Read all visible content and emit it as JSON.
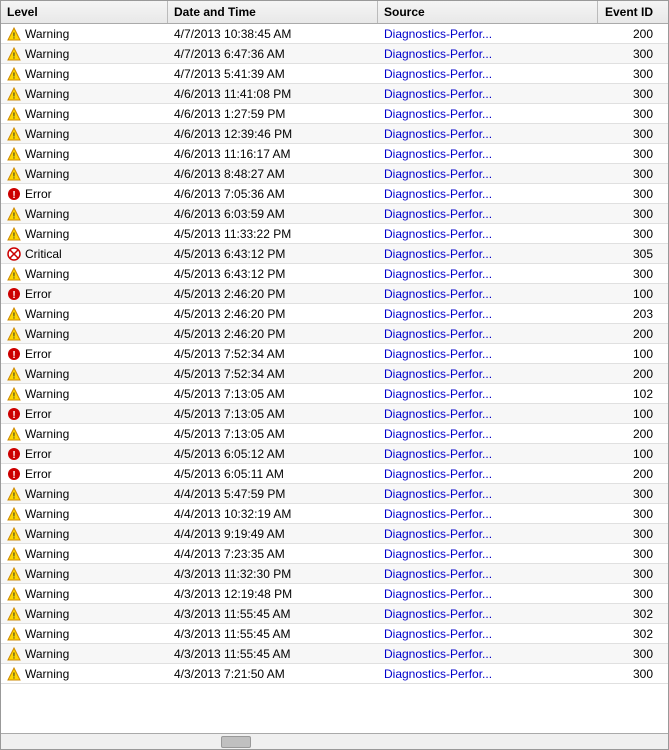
{
  "table": {
    "columns": [
      {
        "id": "level",
        "label": "Level"
      },
      {
        "id": "datetime",
        "label": "Date and Time"
      },
      {
        "id": "source",
        "label": "Source"
      },
      {
        "id": "eventid",
        "label": "Event ID"
      }
    ],
    "rows": [
      {
        "level": "Warning",
        "type": "warning",
        "datetime": "4/7/2013 10:38:45 AM",
        "source": "Diagnostics-Perfor...",
        "eventid": "200"
      },
      {
        "level": "Warning",
        "type": "warning",
        "datetime": "4/7/2013 6:47:36 AM",
        "source": "Diagnostics-Perfor...",
        "eventid": "300"
      },
      {
        "level": "Warning",
        "type": "warning",
        "datetime": "4/7/2013 5:41:39 AM",
        "source": "Diagnostics-Perfor...",
        "eventid": "300"
      },
      {
        "level": "Warning",
        "type": "warning",
        "datetime": "4/6/2013 11:41:08 PM",
        "source": "Diagnostics-Perfor...",
        "eventid": "300"
      },
      {
        "level": "Warning",
        "type": "warning",
        "datetime": "4/6/2013 1:27:59 PM",
        "source": "Diagnostics-Perfor...",
        "eventid": "300"
      },
      {
        "level": "Warning",
        "type": "warning",
        "datetime": "4/6/2013 12:39:46 PM",
        "source": "Diagnostics-Perfor...",
        "eventid": "300"
      },
      {
        "level": "Warning",
        "type": "warning",
        "datetime": "4/6/2013 11:16:17 AM",
        "source": "Diagnostics-Perfor...",
        "eventid": "300"
      },
      {
        "level": "Warning",
        "type": "warning",
        "datetime": "4/6/2013 8:48:27 AM",
        "source": "Diagnostics-Perfor...",
        "eventid": "300"
      },
      {
        "level": "Error",
        "type": "error",
        "datetime": "4/6/2013 7:05:36 AM",
        "source": "Diagnostics-Perfor...",
        "eventid": "300"
      },
      {
        "level": "Warning",
        "type": "warning",
        "datetime": "4/6/2013 6:03:59 AM",
        "source": "Diagnostics-Perfor...",
        "eventid": "300"
      },
      {
        "level": "Warning",
        "type": "warning",
        "datetime": "4/5/2013 11:33:22 PM",
        "source": "Diagnostics-Perfor...",
        "eventid": "300"
      },
      {
        "level": "Critical",
        "type": "critical",
        "datetime": "4/5/2013 6:43:12 PM",
        "source": "Diagnostics-Perfor...",
        "eventid": "305"
      },
      {
        "level": "Warning",
        "type": "warning",
        "datetime": "4/5/2013 6:43:12 PM",
        "source": "Diagnostics-Perfor...",
        "eventid": "300"
      },
      {
        "level": "Error",
        "type": "error",
        "datetime": "4/5/2013 2:46:20 PM",
        "source": "Diagnostics-Perfor...",
        "eventid": "100"
      },
      {
        "level": "Warning",
        "type": "warning",
        "datetime": "4/5/2013 2:46:20 PM",
        "source": "Diagnostics-Perfor...",
        "eventid": "203"
      },
      {
        "level": "Warning",
        "type": "warning",
        "datetime": "4/5/2013 2:46:20 PM",
        "source": "Diagnostics-Perfor...",
        "eventid": "200"
      },
      {
        "level": "Error",
        "type": "error",
        "datetime": "4/5/2013 7:52:34 AM",
        "source": "Diagnostics-Perfor...",
        "eventid": "100"
      },
      {
        "level": "Warning",
        "type": "warning",
        "datetime": "4/5/2013 7:52:34 AM",
        "source": "Diagnostics-Perfor...",
        "eventid": "200"
      },
      {
        "level": "Warning",
        "type": "warning",
        "datetime": "4/5/2013 7:13:05 AM",
        "source": "Diagnostics-Perfor...",
        "eventid": "102"
      },
      {
        "level": "Error",
        "type": "error",
        "datetime": "4/5/2013 7:13:05 AM",
        "source": "Diagnostics-Perfor...",
        "eventid": "100"
      },
      {
        "level": "Warning",
        "type": "warning",
        "datetime": "4/5/2013 7:13:05 AM",
        "source": "Diagnostics-Perfor...",
        "eventid": "200"
      },
      {
        "level": "Error",
        "type": "error",
        "datetime": "4/5/2013 6:05:12 AM",
        "source": "Diagnostics-Perfor...",
        "eventid": "100"
      },
      {
        "level": "Error",
        "type": "error",
        "datetime": "4/5/2013 6:05:11 AM",
        "source": "Diagnostics-Perfor...",
        "eventid": "200"
      },
      {
        "level": "Warning",
        "type": "warning",
        "datetime": "4/4/2013 5:47:59 PM",
        "source": "Diagnostics-Perfor...",
        "eventid": "300"
      },
      {
        "level": "Warning",
        "type": "warning",
        "datetime": "4/4/2013 10:32:19 AM",
        "source": "Diagnostics-Perfor...",
        "eventid": "300"
      },
      {
        "level": "Warning",
        "type": "warning",
        "datetime": "4/4/2013 9:19:49 AM",
        "source": "Diagnostics-Perfor...",
        "eventid": "300"
      },
      {
        "level": "Warning",
        "type": "warning",
        "datetime": "4/4/2013 7:23:35 AM",
        "source": "Diagnostics-Perfor...",
        "eventid": "300"
      },
      {
        "level": "Warning",
        "type": "warning",
        "datetime": "4/3/2013 11:32:30 PM",
        "source": "Diagnostics-Perfor...",
        "eventid": "300"
      },
      {
        "level": "Warning",
        "type": "warning",
        "datetime": "4/3/2013 12:19:48 PM",
        "source": "Diagnostics-Perfor...",
        "eventid": "300"
      },
      {
        "level": "Warning",
        "type": "warning",
        "datetime": "4/3/2013 11:55:45 AM",
        "source": "Diagnostics-Perfor...",
        "eventid": "302"
      },
      {
        "level": "Warning",
        "type": "warning",
        "datetime": "4/3/2013 11:55:45 AM",
        "source": "Diagnostics-Perfor...",
        "eventid": "302"
      },
      {
        "level": "Warning",
        "type": "warning",
        "datetime": "4/3/2013 11:55:45 AM",
        "source": "Diagnostics-Perfor...",
        "eventid": "300"
      },
      {
        "level": "Warning",
        "type": "warning",
        "datetime": "4/3/2013 7:21:50 AM",
        "source": "Diagnostics-Perfor...",
        "eventid": "300"
      }
    ],
    "icons": {
      "warning": "⚠",
      "error": "🔴",
      "critical": "⊗"
    }
  }
}
